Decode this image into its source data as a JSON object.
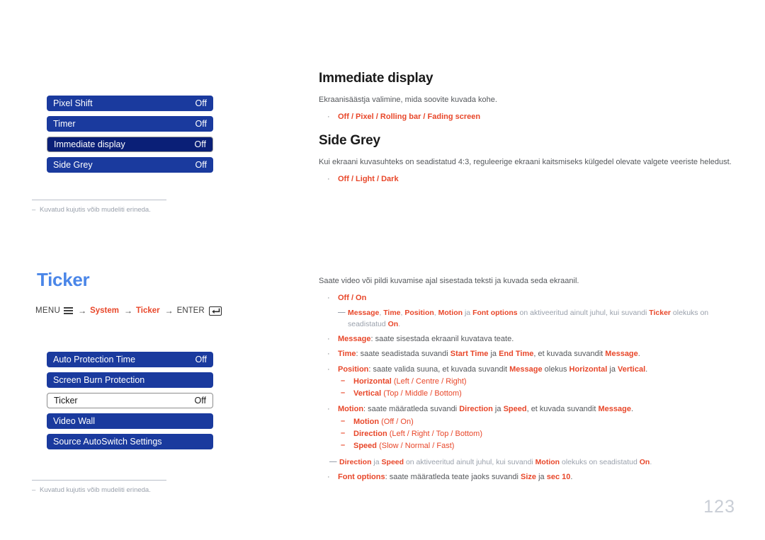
{
  "colors": {
    "osd_blue": "#1a3a9e",
    "osd_blue_selected": "#0a1f77",
    "accent_red": "#e8472a",
    "chapter_blue": "#4a86e8",
    "muted_grey": "#9aa1ac"
  },
  "osd_top": {
    "rows": [
      {
        "label": "Pixel Shift",
        "value": "Off",
        "state": "normal"
      },
      {
        "label": "Timer",
        "value": "Off",
        "state": "normal"
      },
      {
        "label": "Immediate display",
        "value": "Off",
        "state": "selected-dark"
      },
      {
        "label": "Side Grey",
        "value": "Off",
        "state": "normal"
      }
    ]
  },
  "osd_bottom": {
    "rows": [
      {
        "label": "Auto Protection Time",
        "value": "Off",
        "state": "normal"
      },
      {
        "label": "Screen Burn Protection",
        "value": "",
        "state": "normal"
      },
      {
        "label": "Ticker",
        "value": "Off",
        "state": "selected-light"
      },
      {
        "label": "Video Wall",
        "value": "",
        "state": "normal"
      },
      {
        "label": "Source AutoSwitch Settings",
        "value": "",
        "state": "normal"
      }
    ]
  },
  "footnotes": {
    "dash": "–",
    "top_text": "Kuvatud kujutis võib mudeliti erineda.",
    "bottom_text": "Kuvatud kujutis võib mudeliti erineda."
  },
  "chapter": {
    "title": "Ticker",
    "menu_path": {
      "menu_word": "MENU",
      "arrow": "→",
      "step1": "System",
      "step2": "Ticker",
      "enter_word": "ENTER"
    }
  },
  "sections": {
    "immediate_display": {
      "heading": "Immediate display",
      "desc": "Ekraanisäästja valimine, mida soovite kuvada kohe.",
      "options": "Off / Pixel / Rolling bar / Fading screen"
    },
    "side_grey": {
      "heading": "Side Grey",
      "desc": "Kui ekraani kuvasuhteks on seadistatud 4:3, reguleerige ekraani kaitsmiseks külgedel olevate valgete veeriste heledust.",
      "options": "Off / Light / Dark"
    },
    "ticker": {
      "desc": "Saate video või pildi kuvamise ajal sisestada teksti ja kuvada seda ekraanil.",
      "options": "Off / On",
      "note1": {
        "a": "Message",
        "sep1": ", ",
        "b": "Time",
        "sep2": ", ",
        "c": "Position",
        "sep3": ", ",
        "d": "Motion",
        "mid": " ja ",
        "e": "Font options",
        "tail": " on aktiveeritud ainult juhul, kui suvandi ",
        "f": "Ticker",
        "tail2": " olekuks on seadistatud ",
        "g": "On",
        "end": "."
      },
      "bullets": {
        "message": {
          "key": "Message",
          "text": ": saate sisestada ekraanil kuvatava teate."
        },
        "time": {
          "key": "Time",
          "t1": ": saate seadistada suvandi ",
          "b1": "Start Time",
          "t2": " ja ",
          "b2": "End Time",
          "t3": ", et kuvada suvandit ",
          "b3": "Message",
          "t4": "."
        },
        "position": {
          "key": "Position",
          "t1": ": saate valida suuna, et kuvada suvandit ",
          "b1": "Message",
          "t2": " olekus ",
          "b2": "Horizontal",
          "t3": " ja ",
          "b3": "Vertical",
          "t4": ".",
          "subs": [
            {
              "key": "Horizontal",
              "values": " (Left / Centre / Right)"
            },
            {
              "key": "Vertical",
              "values": " (Top / Middle / Bottom)"
            }
          ]
        },
        "motion": {
          "key": "Motion",
          "t1": ": saate määratleda suvandi ",
          "b1": "Direction",
          "t2": " ja ",
          "b2": "Speed",
          "t3": ", et kuvada suvandit ",
          "b3": "Message",
          "t4": ".",
          "subs": [
            {
              "key": "Motion",
              "values": " (Off / On)"
            },
            {
              "key": "Direction",
              "values": " (Left / Right / Top / Bottom)"
            },
            {
              "key": "Speed",
              "values": " (Slow / Normal / Fast)"
            }
          ],
          "note": {
            "a": "Direction",
            "mid": " ja ",
            "b": "Speed",
            "tail": " on aktiveeritud ainult juhul, kui suvandi ",
            "c": "Motion",
            "tail2": " olekuks on seadistatud ",
            "d": "On",
            "end": "."
          }
        },
        "font_options": {
          "key": "Font options",
          "t1": ": saate määratleda teate jaoks suvandi ",
          "b1": "Size",
          "t2": " ja ",
          "b2": "sec 10",
          "t3": "."
        }
      }
    }
  },
  "page_number": "123"
}
